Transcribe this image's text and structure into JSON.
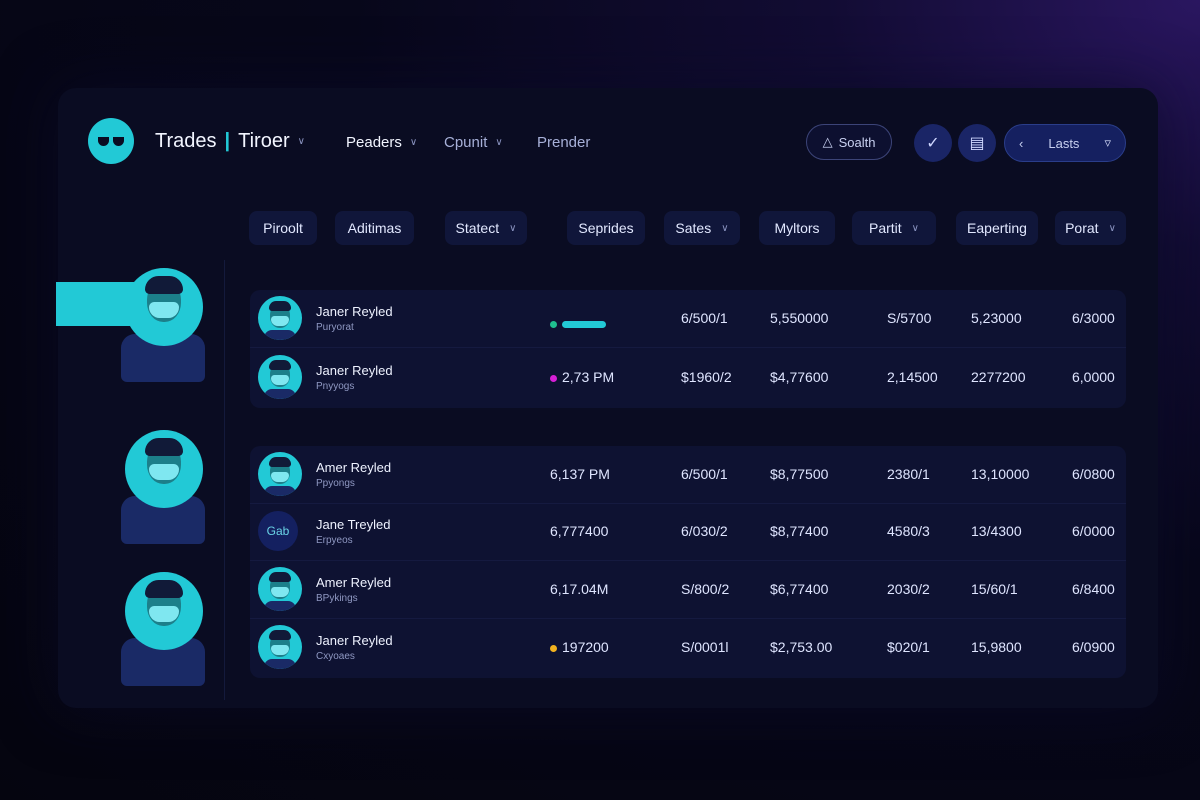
{
  "header": {
    "brand_left": "Trades",
    "brand_sep": "|",
    "brand_right": "Tiroer",
    "nav": [
      {
        "label": "Peaders",
        "has_chevron": true,
        "active": true
      },
      {
        "label": "Cpunit",
        "has_chevron": true,
        "active": false
      },
      {
        "label": "Prender",
        "has_chevron": false,
        "active": false
      }
    ],
    "search_label": "Soalth",
    "lasts_label": "Lasts"
  },
  "filters": [
    {
      "label": "Piroolt",
      "chevron": false
    },
    {
      "label": "Aditimas",
      "chevron": false
    },
    {
      "label": "Statect",
      "chevron": true
    },
    {
      "label": "Seprides",
      "chevron": false
    },
    {
      "label": "Sates",
      "chevron": true
    },
    {
      "label": "Myltors",
      "chevron": false
    },
    {
      "label": "Partit",
      "chevron": true
    },
    {
      "label": "Eaperting",
      "chevron": false
    },
    {
      "label": "Porat",
      "chevron": true
    }
  ],
  "rows": [
    {
      "name": "Janer Reyled",
      "sub": "Puryorat",
      "status": {
        "kind": "bar",
        "color": "#22c9d6",
        "text": ""
      },
      "c1": "6/500/1",
      "c2": "5,550000",
      "c3": "S/5700",
      "c4": "5,23000",
      "c5": "6/3000"
    },
    {
      "name": "Janer Reyled",
      "sub": "Pnyyogs",
      "status": {
        "kind": "dot",
        "color": "#d61fd6",
        "text": "2,73 PM"
      },
      "c1": "$1960/2",
      "c2": "$4,77600",
      "c3": "2,14500",
      "c4": "2277200",
      "c5": "6,0000"
    },
    {
      "name": "Amer Reyled",
      "sub": "Ppyongs",
      "status": {
        "kind": "text",
        "color": "",
        "text": "6,137 PM"
      },
      "c1": "6/500/1",
      "c2": "$8,77500",
      "c3": "2380/1",
      "c4": "13,10000",
      "c5": "6/0800"
    },
    {
      "name": "Jane Treyled",
      "sub": "Erpyeos",
      "status": {
        "kind": "text",
        "color": "",
        "text": "6,777400"
      },
      "c1": "6/030/2",
      "c2": "$8,77400",
      "c3": "4580/3",
      "c4": "13/4300",
      "c5": "6/0000"
    },
    {
      "name": "Amer Reyled",
      "sub": "BPykings",
      "status": {
        "kind": "text",
        "color": "",
        "text": "6,17.04M"
      },
      "c1": "S/800/2",
      "c2": "$6,77400",
      "c3": "2030/2",
      "c4": "15/60/1",
      "c5": "6/8400"
    },
    {
      "name": "Janer Reyled",
      "sub": "Cxyoaes",
      "status": {
        "kind": "dot",
        "color": "#f2b21f",
        "text": "197200"
      },
      "c1": "S/0001l",
      "c2": "$2,753.00",
      "c3": "$020/1",
      "c4": "15,9800",
      "c5": "6/0900"
    }
  ],
  "row4_avatar_text": "Gab"
}
